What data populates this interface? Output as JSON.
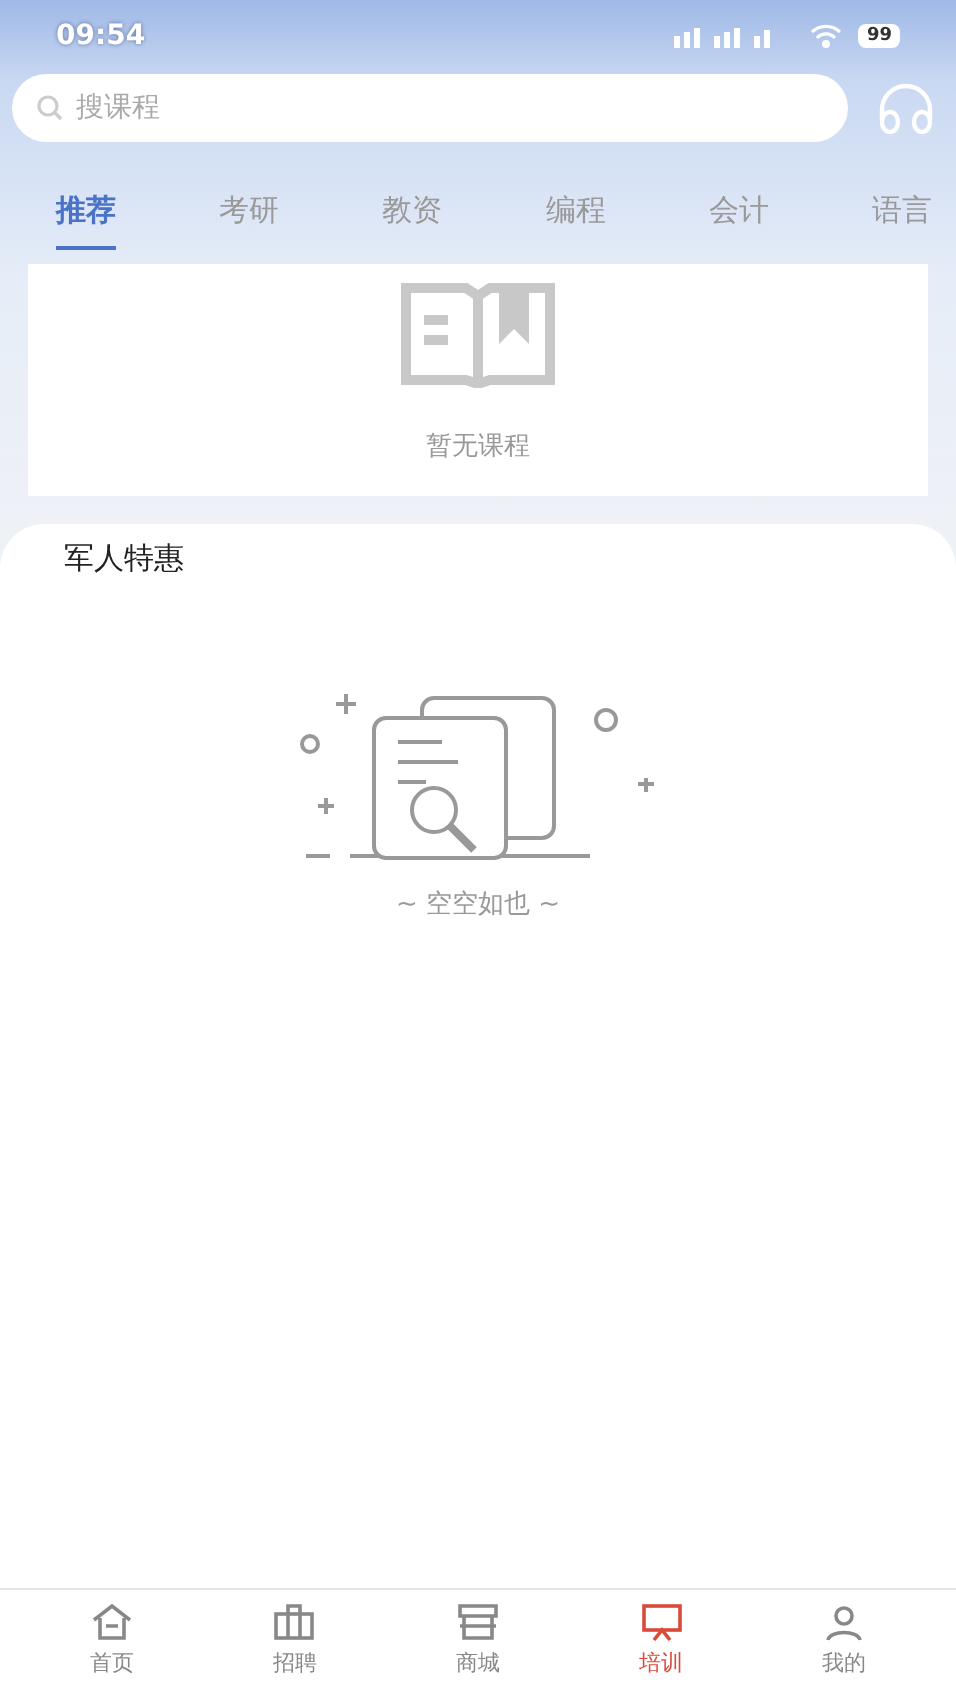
{
  "status_bar": {
    "time": "09:54",
    "battery": "99"
  },
  "search": {
    "placeholder": "搜课程"
  },
  "tabs": [
    {
      "label": "推荐",
      "selected": true
    },
    {
      "label": "考研",
      "selected": false
    },
    {
      "label": "教资",
      "selected": false
    },
    {
      "label": "编程",
      "selected": false
    },
    {
      "label": "会计",
      "selected": false
    },
    {
      "label": "语言",
      "selected": false
    }
  ],
  "course_card": {
    "empty_text": "暂无课程"
  },
  "section": {
    "title": "军人特惠",
    "empty_text": "~ 空空如也 ~"
  },
  "bottom_nav": [
    {
      "label": "首页",
      "kind": "home",
      "selected": false
    },
    {
      "label": "招聘",
      "kind": "briefcase",
      "selected": false
    },
    {
      "label": "商城",
      "kind": "store",
      "selected": false
    },
    {
      "label": "培训",
      "kind": "training",
      "selected": true
    },
    {
      "label": "我的",
      "kind": "user",
      "selected": false
    }
  ]
}
